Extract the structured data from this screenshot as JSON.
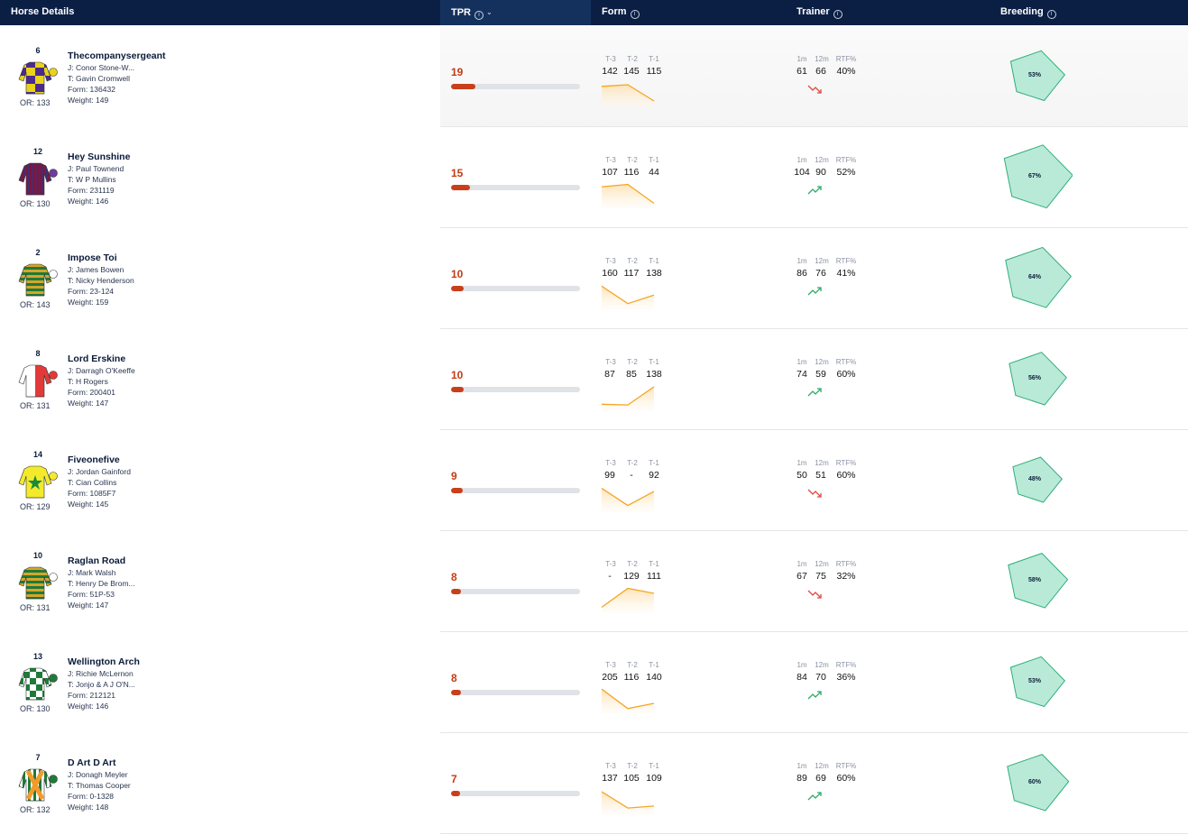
{
  "header": {
    "horse_details": "Horse Details",
    "tpr": "TPR",
    "form": "Form",
    "trainer": "Trainer",
    "breeding": "Breeding"
  },
  "form_labels": [
    "T-3",
    "T-2",
    "T-1"
  ],
  "trainer_labels": [
    "1m",
    "12m",
    "RTF%"
  ],
  "colors": {
    "header_bg": "#0b1f44",
    "tpr_accent": "#c33b14",
    "form_line": "#f5a524",
    "trend_up": "#2fa86b",
    "trend_down": "#e0463a",
    "breeding_fill": "#b9ead7"
  },
  "runners": [
    {
      "number": "6",
      "or": "OR: 133",
      "name": "Thecompanysergeant",
      "jockey": "J: Conor Stone-W...",
      "trainer": "T: Gavin Cromwell",
      "form": "Form: 136432",
      "weight": "Weight: 149",
      "tpr": "19",
      "tpr_fraction": 0.19,
      "form_values": [
        "142",
        "145",
        "115"
      ],
      "form_points": [
        142,
        145,
        115
      ],
      "trainer_stats": [
        "61",
        "66",
        "40%"
      ],
      "trend": "down",
      "breeding": "53%",
      "breeding_fraction": 0.53,
      "silk": "purple-yellow-quarters-icon"
    },
    {
      "number": "12",
      "or": "OR: 130",
      "name": "Hey Sunshine",
      "jockey": "J: Paul Townend",
      "trainer": "T: W P Mullins",
      "form": "Form: 231119",
      "weight": "Weight: 146",
      "tpr": "15",
      "tpr_fraction": 0.15,
      "form_values": [
        "107",
        "116",
        "44"
      ],
      "form_points": [
        107,
        116,
        44
      ],
      "trainer_stats": [
        "104",
        "90",
        "52%"
      ],
      "trend": "up",
      "breeding": "67%",
      "breeding_fraction": 0.67,
      "silk": "maroon-stripes-icon"
    },
    {
      "number": "2",
      "or": "OR: 143",
      "name": "Impose Toi",
      "jockey": "J: James Bowen",
      "trainer": "T: Nicky Henderson",
      "form": "Form: 23-124",
      "weight": "Weight: 159",
      "tpr": "10",
      "tpr_fraction": 0.1,
      "form_values": [
        "160",
        "117",
        "138"
      ],
      "form_points": [
        160,
        117,
        138
      ],
      "trainer_stats": [
        "86",
        "76",
        "41%"
      ],
      "trend": "up",
      "breeding": "64%",
      "breeding_fraction": 0.64,
      "silk": "green-gold-hoops-icon"
    },
    {
      "number": "8",
      "or": "OR: 131",
      "name": "Lord Erskine",
      "jockey": "J: Darragh O'Keeffe",
      "trainer": "T: H Rogers",
      "form": "Form: 200401",
      "weight": "Weight: 147",
      "tpr": "10",
      "tpr_fraction": 0.1,
      "form_values": [
        "87",
        "85",
        "138"
      ],
      "form_points": [
        87,
        85,
        138
      ],
      "trainer_stats": [
        "74",
        "59",
        "60%"
      ],
      "trend": "up",
      "breeding": "56%",
      "breeding_fraction": 0.56,
      "silk": "white-red-halves-icon"
    },
    {
      "number": "14",
      "or": "OR: 129",
      "name": "Fiveonefive",
      "jockey": "J: Jordan Gainford",
      "trainer": "T: Cian Collins",
      "form": "Form: 1085F7",
      "weight": "Weight: 145",
      "tpr": "9",
      "tpr_fraction": 0.09,
      "form_values": [
        "99",
        "-",
        "92"
      ],
      "form_points": [
        99,
        60,
        92
      ],
      "trainer_stats": [
        "50",
        "51",
        "60%"
      ],
      "trend": "down",
      "breeding": "48%",
      "breeding_fraction": 0.48,
      "silk": "yellow-green-star-icon"
    },
    {
      "number": "10",
      "or": "OR: 131",
      "name": "Raglan Road",
      "jockey": "J: Mark Walsh",
      "trainer": "T: Henry De Brom...",
      "form": "Form: 51P-53",
      "weight": "Weight: 147",
      "tpr": "8",
      "tpr_fraction": 0.08,
      "form_values": [
        "-",
        "129",
        "111"
      ],
      "form_points": [
        60,
        129,
        111
      ],
      "trainer_stats": [
        "67",
        "75",
        "32%"
      ],
      "trend": "down",
      "breeding": "58%",
      "breeding_fraction": 0.58,
      "silk": "green-gold-hoops-icon"
    },
    {
      "number": "13",
      "or": "OR: 130",
      "name": "Wellington Arch",
      "jockey": "J: Richie McLernon",
      "trainer": "T: Jonjo & A J O'N...",
      "form": "Form: 212121",
      "weight": "Weight: 146",
      "tpr": "8",
      "tpr_fraction": 0.08,
      "form_values": [
        "205",
        "116",
        "140"
      ],
      "form_points": [
        205,
        116,
        140
      ],
      "trainer_stats": [
        "84",
        "70",
        "36%"
      ],
      "trend": "up",
      "breeding": "53%",
      "breeding_fraction": 0.53,
      "silk": "green-white-check-icon"
    },
    {
      "number": "7",
      "or": "OR: 132",
      "name": "D Art D Art",
      "jockey": "J: Donagh Meyler",
      "trainer": "T: Thomas Cooper",
      "form": "Form: 0-1328",
      "weight": "Weight: 148",
      "tpr": "7",
      "tpr_fraction": 0.07,
      "form_values": [
        "137",
        "105",
        "109"
      ],
      "form_points": [
        137,
        105,
        109
      ],
      "trainer_stats": [
        "89",
        "69",
        "60%"
      ],
      "trend": "up",
      "breeding": "60%",
      "breeding_fraction": 0.6,
      "silk": "green-orange-cross-belts-icon"
    }
  ]
}
